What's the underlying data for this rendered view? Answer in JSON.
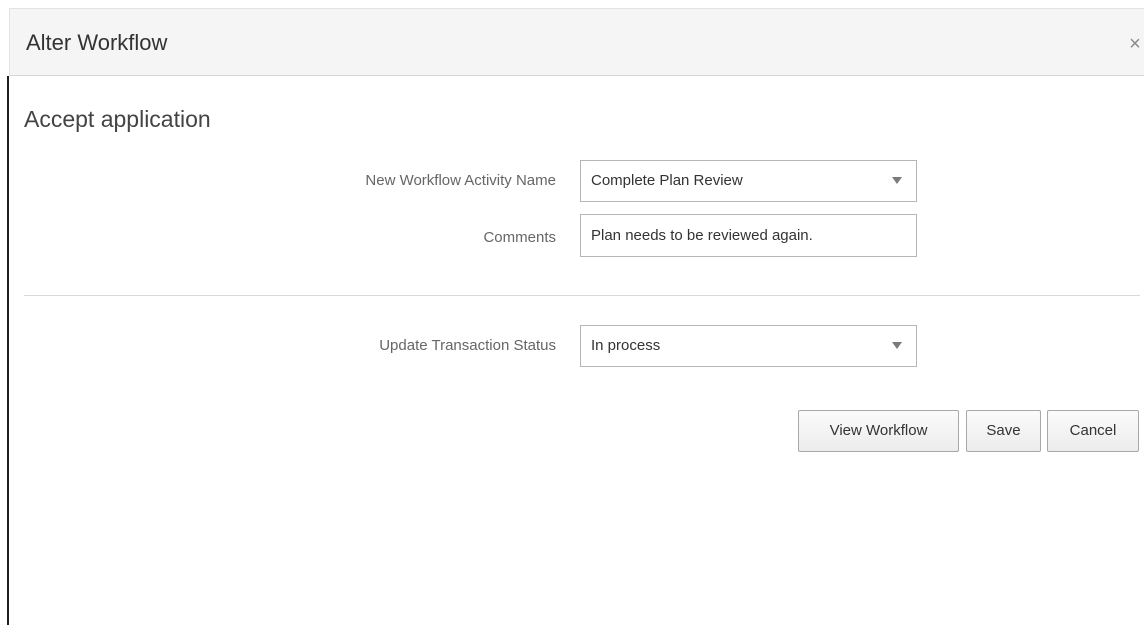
{
  "dialog": {
    "title": "Alter Workflow",
    "close_icon": "close-icon",
    "close_glyph": "×"
  },
  "section": {
    "title": "Accept application"
  },
  "form": {
    "activity": {
      "label": "New Workflow Activity Name",
      "value": "Complete Plan Review"
    },
    "comments": {
      "label": "Comments",
      "value": "Plan needs to be reviewed again."
    },
    "status": {
      "label": "Update Transaction Status",
      "value": "In process"
    }
  },
  "buttons": {
    "view_workflow": "View Workflow",
    "save": "Save",
    "cancel": "Cancel"
  },
  "colors": {
    "header_bg": "#f5f5f5",
    "border": "#b6b6b6",
    "label": "#666666"
  }
}
